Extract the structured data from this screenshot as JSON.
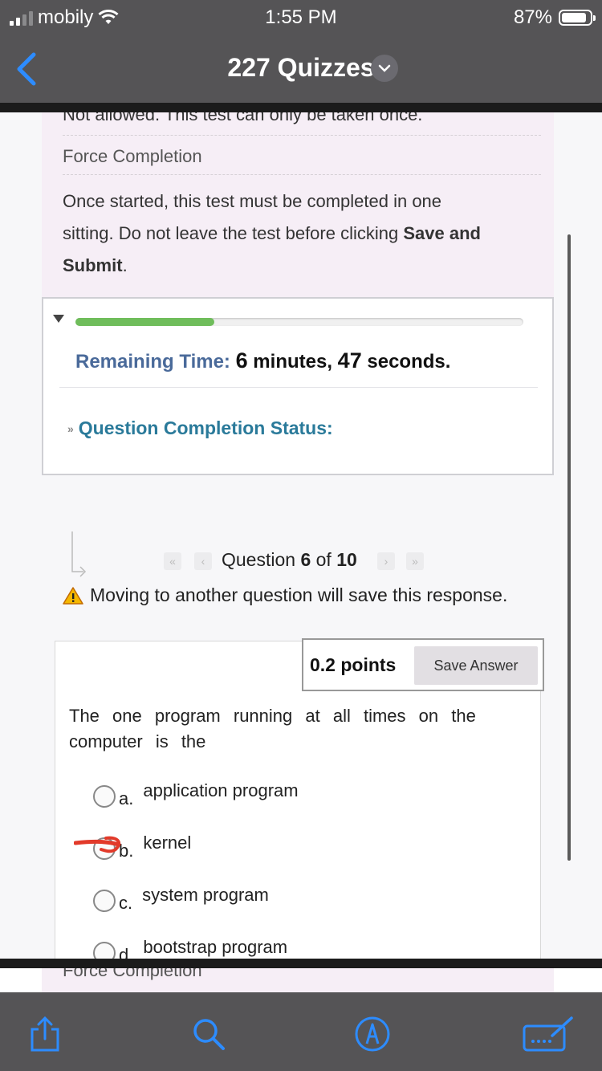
{
  "status_bar": {
    "carrier": "mobily",
    "time": "1:55 PM",
    "battery": "87%"
  },
  "nav": {
    "title": "227 Quizzes"
  },
  "info": {
    "cut_text": "Not allowed. This test can only be taken once.",
    "force_label": "Force Completion",
    "force_text_1": "Once started, this test must be completed in one",
    "force_text_2": "sitting. Do not leave the test before clicking ",
    "save_and": "Save and",
    "submit": "Submit",
    "period": "."
  },
  "timer": {
    "progress_fraction": 0.31,
    "remaining_label": "Remaining Time:",
    "minutes_num": "6",
    "minutes_word": " minutes, ",
    "seconds_num": "47",
    "seconds_word": " seconds.",
    "completion_status": "Question Completion Status:"
  },
  "question_nav": {
    "prefix": "Question ",
    "current": "6",
    "of": " of ",
    "total": "10",
    "warning": "Moving to another question will save this response."
  },
  "question": {
    "points": "0.2 points",
    "save_button": "Save Answer",
    "text": "The one program running at all times on the computer is the",
    "options": [
      {
        "letter": "a.",
        "text": "application program"
      },
      {
        "letter": "b.",
        "text": "kernel"
      },
      {
        "letter": "c.",
        "text": "system program"
      },
      {
        "letter": "d.",
        "text": "bootstrap program"
      }
    ]
  },
  "footer_peek": "Force Completion",
  "colors": {
    "progress": "#6fbd5b",
    "accent_blue": "#2a7a9a",
    "label_blue": "#4a6a9a",
    "ios_blue": "#2d8cff",
    "annotation_red": "#e23a2a"
  },
  "icons": [
    "signal-icon",
    "wifi-icon",
    "battery-icon",
    "back-chevron-icon",
    "dropdown-chevron-icon",
    "share-icon",
    "search-icon",
    "markup-icon",
    "keyboard-compose-icon",
    "warning-icon"
  ]
}
